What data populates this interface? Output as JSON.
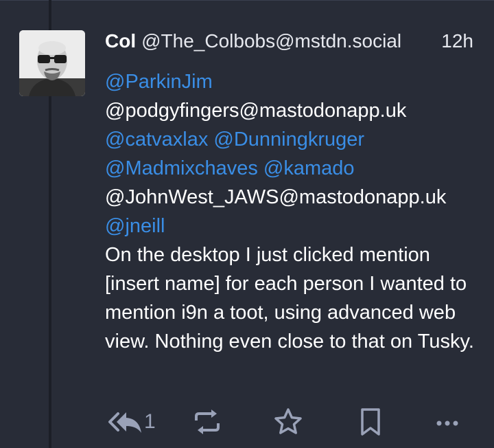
{
  "status": {
    "author": {
      "display_name": "Col",
      "username": "@The_Colbobs@mstdn.social"
    },
    "timestamp": "12h",
    "mentions": [
      [
        "@ParkinJim"
      ],
      [
        "@podgyfingers@mastodonapp.uk"
      ],
      [
        "@catvaxlax",
        "@Dunningkruger"
      ],
      [
        "@Madmixchaves",
        "@kamado"
      ],
      [
        "@JohnWest_JAWS@mastodonapp.uk"
      ],
      [
        "@jneill"
      ]
    ],
    "body": "On the desktop I just clicked mention [insert name] for each person I wanted to mention i9n a toot, using advanced web view.  Nothing even close to that on Tusky."
  },
  "actions": {
    "reply_count": "1",
    "icons": [
      "reply-all-icon",
      "boost-icon",
      "favourite-icon",
      "bookmark-icon",
      "more-icon"
    ]
  },
  "colors": {
    "background": "#282c37",
    "link": "#3a8ee6",
    "icon": "#9aa2b8",
    "text": "#ffffff"
  }
}
